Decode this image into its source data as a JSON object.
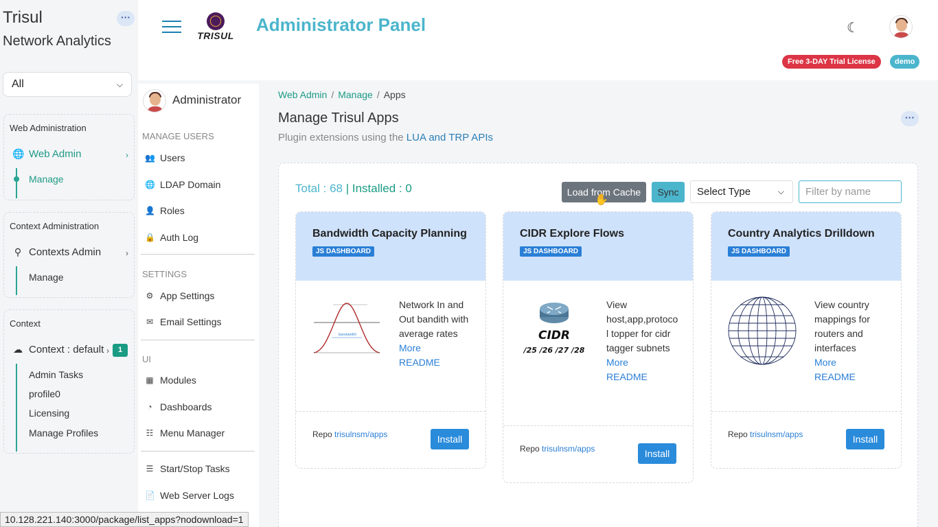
{
  "brand": {
    "title": "Trisul",
    "subtitle": "Network Analytics"
  },
  "filter_select": {
    "value": "All"
  },
  "left_nav": {
    "web_admin_group": {
      "title": "Web Administration",
      "item": "Web Admin",
      "sub": "Manage"
    },
    "context_admin_group": {
      "title": "Context Administration",
      "item": "Contexts Admin",
      "sub": "Manage"
    },
    "context_group": {
      "title": "Context",
      "item": "Context : default",
      "badge": "1",
      "subs": [
        "Admin Tasks",
        "profile0",
        "Licensing",
        "Manage Profiles"
      ]
    }
  },
  "header": {
    "logo_text": "TRISUL",
    "title": "Administrator Panel",
    "trial_badge": "Free 3-DAY Trial License",
    "user_badge": "demo"
  },
  "admin_sidebar": {
    "name": "Administrator",
    "manage_users_title": "MANAGE USERS",
    "manage_users": [
      "Users",
      "LDAP Domain",
      "Roles",
      "Auth Log"
    ],
    "settings_title": "SETTINGS",
    "settings": [
      "App Settings",
      "Email Settings"
    ],
    "ui_title": "UI",
    "ui": [
      "Modules",
      "Dashboards",
      "Menu Manager"
    ],
    "misc": [
      "Start/Stop Tasks",
      "Web Server Logs"
    ]
  },
  "breadcrumb": {
    "item1": "Web Admin",
    "sep": "/",
    "item2": "Manage",
    "item3": "Apps"
  },
  "page": {
    "title": "Manage Trisul Apps",
    "subtitle_prefix": "Plugin extensions using the",
    "subtitle_link": "LUA and TRP APIs"
  },
  "toolbar": {
    "total": "Total : 68",
    "installed": "| Installed : 0",
    "load_cache": "Load from Cache",
    "sync": "Sync",
    "select_type": "Select Type",
    "filter_placeholder": "Filter by name"
  },
  "cards": [
    {
      "title": "Bandwidth Capacity Planning",
      "tag": "JS DASHBOARD",
      "desc": "Network In and Out bandith with average rates",
      "more": "More",
      "readme": "README",
      "repo_label": "Repo",
      "repo_link": "trisulnsm/apps",
      "install": "Install",
      "img_label": "bandwidth"
    },
    {
      "title": "CIDR Explore Flows",
      "tag": "JS DASHBOARD",
      "desc": "View host,app,protocol topper for cidr tagger subnets",
      "more": "More",
      "readme": "README",
      "repo_label": "Repo",
      "repo_link": "trisulnsm/apps",
      "install": "Install",
      "img_title": "CIDR",
      "img_sub": "/25 /26 /27 /28"
    },
    {
      "title": "Country Analytics Drilldown",
      "tag": "JS DASHBOARD",
      "desc": "View country mappings for routers and interfaces",
      "more": "More",
      "readme": "README",
      "repo_label": "Repo",
      "repo_link": "trisulnsm/apps",
      "install": "Install"
    }
  ],
  "status_url": "10.128.221.140:3000/package/list_apps?nodownload=1"
}
